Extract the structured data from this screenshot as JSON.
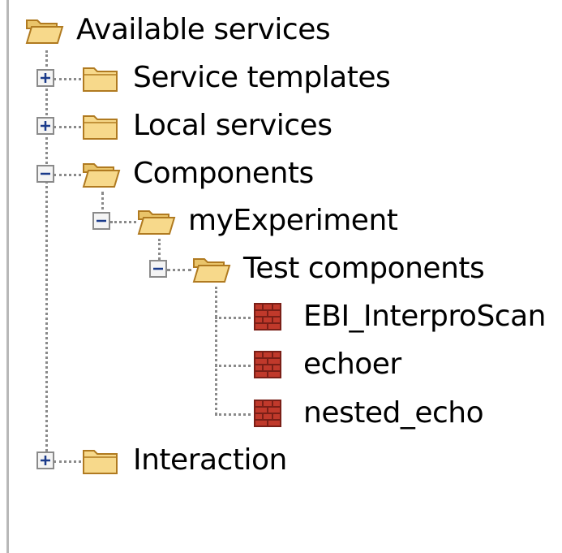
{
  "tree": {
    "root": {
      "label": "Available services",
      "icon": "folder-open-icon",
      "expanded": true
    },
    "children": [
      {
        "label": "Service templates",
        "icon": "folder-icon",
        "toggle": "+"
      },
      {
        "label": "Local services",
        "icon": "folder-icon",
        "toggle": "+"
      },
      {
        "label": "Components",
        "icon": "folder-open-icon",
        "toggle": "-",
        "children": [
          {
            "label": "myExperiment",
            "icon": "folder-open-icon",
            "toggle": "-",
            "children": [
              {
                "label": "Test components",
                "icon": "folder-open-icon",
                "toggle": "-",
                "children": [
                  {
                    "label": "EBI_InterproScan",
                    "icon": "workflow-brick-icon"
                  },
                  {
                    "label": "echoer",
                    "icon": "workflow-brick-icon"
                  },
                  {
                    "label": "nested_echo",
                    "icon": "workflow-brick-icon"
                  }
                ]
              }
            ]
          }
        ]
      },
      {
        "label": "Interaction",
        "icon": "folder-icon",
        "toggle": "+"
      }
    ]
  },
  "colors": {
    "folder_fill": "#f7d98b",
    "folder_outline": "#b07a20",
    "brick_fill": "#c0392b",
    "connector": "#8a8a8a",
    "toggle_border": "#8a8a8a"
  }
}
